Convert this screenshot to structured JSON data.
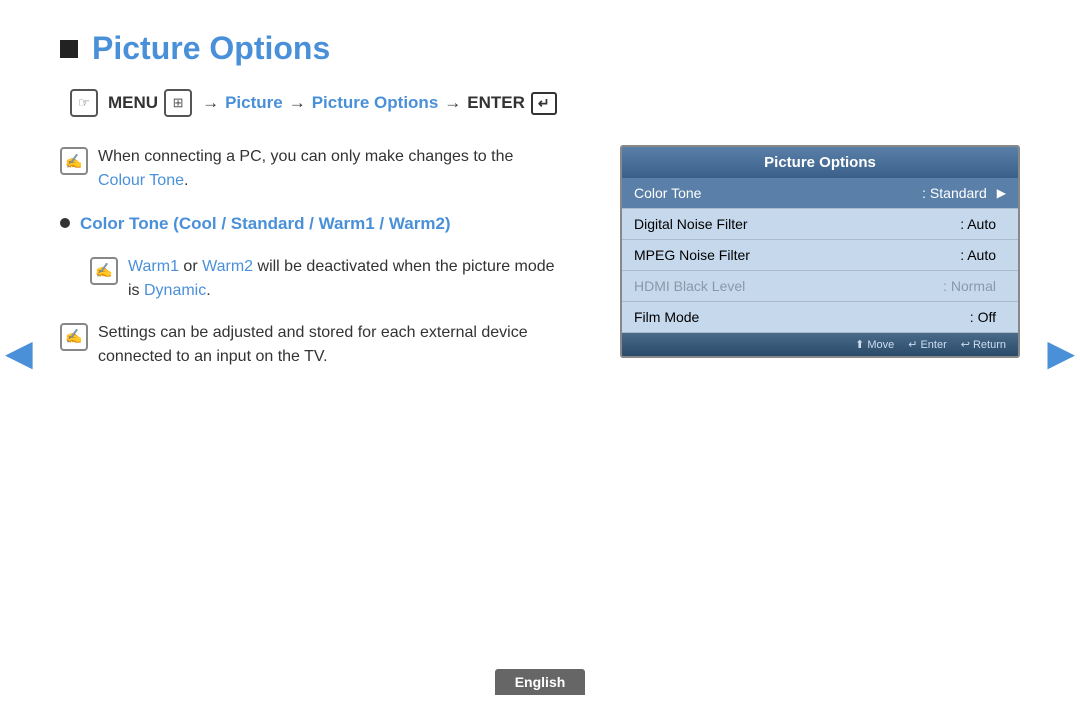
{
  "page": {
    "title": "Picture Options",
    "title_square": "■",
    "menu_path": {
      "menu_label": "MENU",
      "arrow1": "→",
      "step1": "Picture",
      "arrow2": "→",
      "step2": "Picture Options",
      "arrow3": "→",
      "enter_label": "ENTER"
    },
    "notes": [
      {
        "id": "note1",
        "icon": "✍",
        "text_parts": [
          {
            "text": "When connecting a PC, you can only make changes to the "
          },
          {
            "text": "Colour Tone",
            "color": "blue"
          },
          {
            "text": "."
          }
        ],
        "plain": "When connecting a PC, you can only make changes to the Colour Tone."
      },
      {
        "id": "note2",
        "icon": "✍",
        "sub_note": true,
        "text_parts": [
          {
            "text": "Warm1",
            "color": "blue"
          },
          {
            "text": " or "
          },
          {
            "text": "Warm2",
            "color": "blue"
          },
          {
            "text": " will be deactivated when the picture mode is "
          },
          {
            "text": "Dynamic",
            "color": "blue"
          },
          {
            "text": "."
          }
        ]
      },
      {
        "id": "note3",
        "icon": "✍",
        "text_parts": [
          {
            "text": "Settings can be adjusted and stored for each external device connected to an input on the TV."
          }
        ]
      }
    ],
    "bullet": {
      "label": "Color Tone (Cool / Standard / Warm1 / Warm2)"
    },
    "tv_ui": {
      "header": "Picture Options",
      "menu_items": [
        {
          "label": "Color Tone",
          "value": ": Standard",
          "selected": true,
          "has_arrow": true
        },
        {
          "label": "Digital Noise Filter",
          "value": ": Auto",
          "selected": false
        },
        {
          "label": "MPEG Noise Filter",
          "value": ": Auto",
          "selected": false
        },
        {
          "label": "HDMI Black Level",
          "value": ": Normal",
          "selected": false,
          "disabled": true
        },
        {
          "label": "Film Mode",
          "value": ": Off",
          "selected": false
        }
      ],
      "footer": [
        {
          "icon": "⬆",
          "label": "Move"
        },
        {
          "icon": "↵",
          "label": "Enter"
        },
        {
          "icon": "↩",
          "label": "Return"
        }
      ]
    },
    "nav": {
      "left_arrow": "◀",
      "right_arrow": "▶"
    },
    "language_tab": "English"
  }
}
